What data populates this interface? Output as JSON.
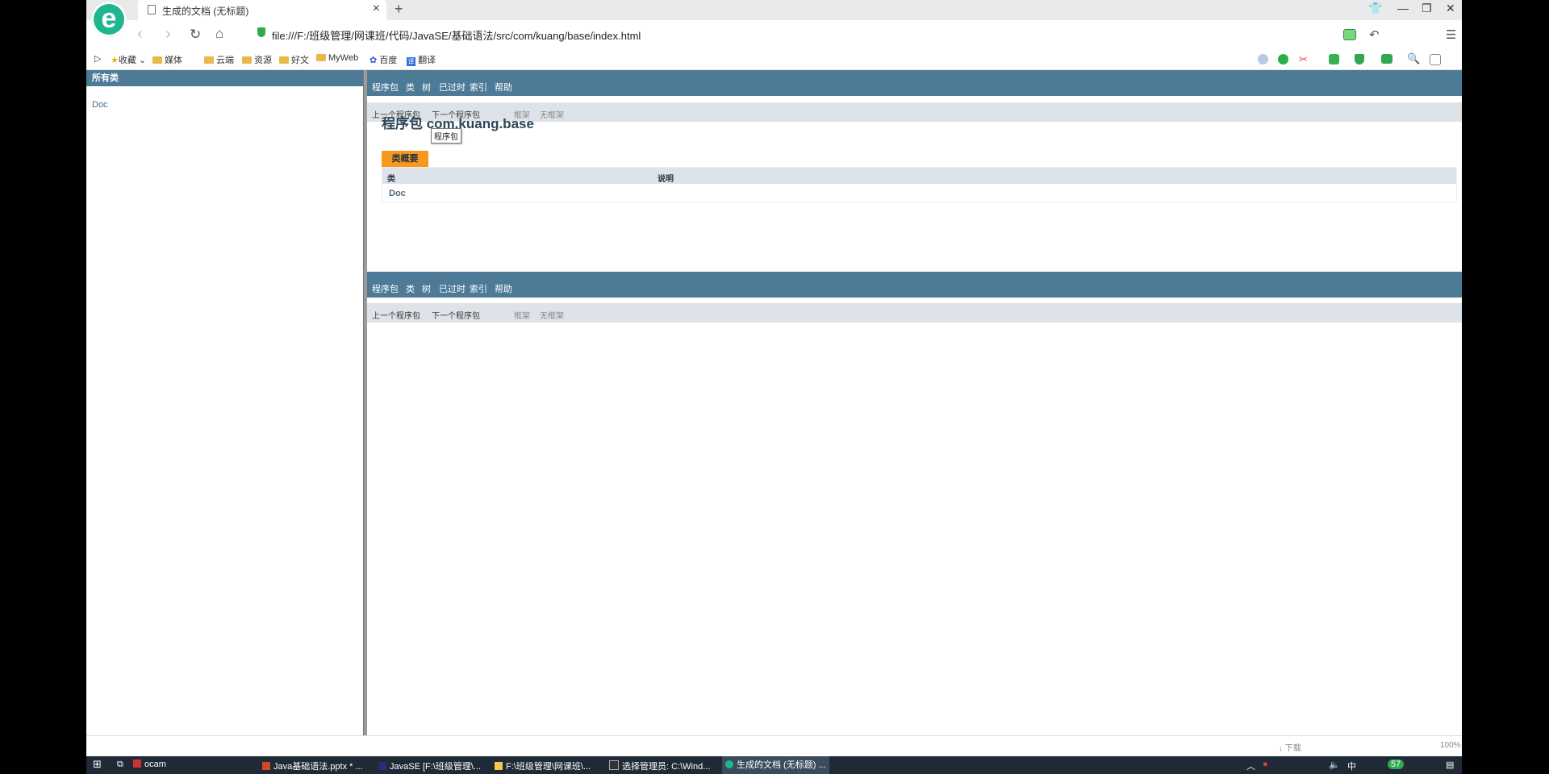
{
  "browser": {
    "tab_title": "生成的文档 (无标题)",
    "tab_close": "×",
    "new_tab": "+",
    "url": "file:///F:/班级管理/网课班/代码/JavaSE/基础语法/src/com/kuang/base/index.html",
    "logo_text": "e",
    "window_controls": {
      "minimize": "—",
      "restore": "❐",
      "close": "✕",
      "skin": "👕"
    }
  },
  "bookmarks": {
    "expand": "▷",
    "items": [
      "收藏",
      "媒体",
      "云端",
      "资源",
      "好文",
      "MyWeb",
      "百度",
      "翻译"
    ]
  },
  "left_frame": {
    "header": "所有类",
    "classes": [
      "Doc"
    ]
  },
  "right_frame": {
    "top_nav": [
      "程序包",
      "类",
      "树",
      "已过时",
      "索引",
      "帮助"
    ],
    "sub_nav": [
      "上一个程序包",
      "下一个程序包",
      "框架",
      "无框架"
    ],
    "package_title": "程序包 com.kuang.base",
    "tooltip": "程序包",
    "summary_caption": "类概要",
    "table_headers": [
      "类",
      "说明"
    ],
    "table_rows": [
      {
        "class": "Doc",
        "desc": ""
      }
    ]
  },
  "status_bar": {
    "download": "↓ 下载",
    "zoom": "100%"
  },
  "taskbar": {
    "items": [
      "ocam",
      "Java基础语法.pptx * ...",
      "JavaSE [F:\\班级管理\\...",
      "F:\\班级管理\\网课班\\...",
      "选择管理员: C:\\Wind...",
      "生成的文档 (无标题) ..."
    ],
    "tray_lang": "中",
    "tray_badge": "57"
  },
  "colors": {
    "java_header": "#4d7a97",
    "java_subnav": "#dee3e9",
    "summary_tab": "#f8981d",
    "taskbar": "#1f2a36"
  }
}
